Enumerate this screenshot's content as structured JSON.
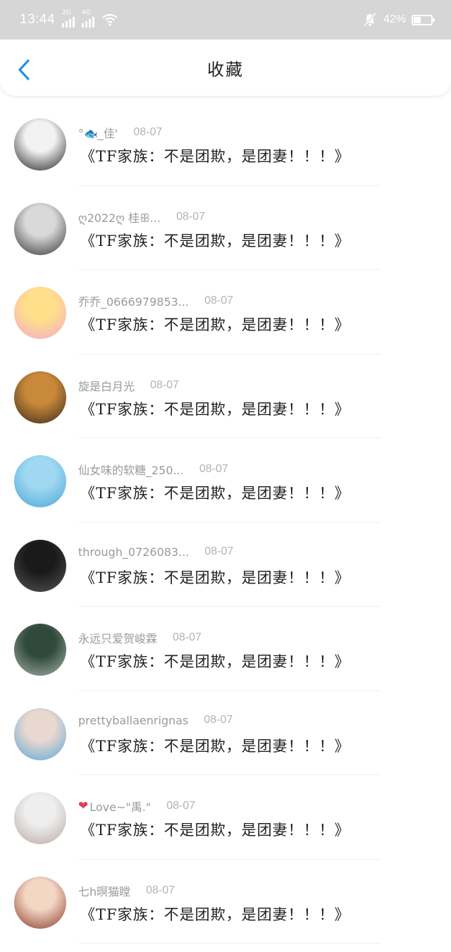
{
  "status_bar": {
    "time": "13:44",
    "signal1_tag": "2G",
    "signal2_tag": "4G",
    "battery_percent": "42%",
    "battery_level": 0.42
  },
  "header": {
    "title": "收藏",
    "back_icon": "chevron-left-icon"
  },
  "colors": {
    "accent": "#2b8de9",
    "status_bar_bg": "#d6d6d6",
    "username": "#9a9a9a",
    "date": "#b3b3b3"
  },
  "items": [
    {
      "username": "°🐟_佳'",
      "date": "08-07",
      "content": "《TF家族：不是团欺，是团妻！！！》",
      "avatar_colors": [
        "#f2f2f2",
        "#222222"
      ]
    },
    {
      "username": "ღ2022ღ 桂ꕥ...",
      "date": "08-07",
      "content": "《TF家族：不是团欺，是团妻！！！》",
      "avatar_colors": [
        "#d9d9d9",
        "#333333"
      ]
    },
    {
      "username": "乔乔_0666979853...",
      "date": "08-07",
      "content": "《TF家族：不是团欺，是团妻！！！》",
      "avatar_colors": [
        "#ffe08a",
        "#f4a8c9"
      ]
    },
    {
      "username": "旋是白月光",
      "date": "08-07",
      "content": "《TF家族：不是团欺，是团妻！！！》",
      "avatar_colors": [
        "#c9893b",
        "#3a2a1c"
      ]
    },
    {
      "username": "仙女味的软糖_250...",
      "date": "08-07",
      "content": "《TF家族：不是团欺，是团妻！！！》",
      "avatar_colors": [
        "#9fd8f0",
        "#4aa7d6"
      ]
    },
    {
      "username": "through_0726083...",
      "date": "08-07",
      "content": "《TF家族：不是团欺，是团妻！！！》",
      "avatar_colors": [
        "#1a1a1a",
        "#555555"
      ]
    },
    {
      "username": "永远只爱贺峻霖",
      "date": "08-07",
      "content": "《TF家族：不是团欺，是团妻！！！》",
      "avatar_colors": [
        "#2f4a3a",
        "#a8b3aa"
      ]
    },
    {
      "username": "prettyballaenrignas",
      "date": "08-07",
      "content": "《TF家族：不是团欺，是团妻！！！》",
      "avatar_colors": [
        "#e8d8d0",
        "#5aa7d8"
      ]
    },
    {
      "username": "Love~\"禹.\"",
      "date": "08-07",
      "content": "《TF家族：不是团欺，是团妻！！！》",
      "avatar_colors": [
        "#eeeeee",
        "#b7a8a3"
      ],
      "heart": "❤"
    },
    {
      "username": "七h暝猫瞠",
      "date": "08-07",
      "content": "《TF家族：不是团欺，是团妻！！！》",
      "avatar_colors": [
        "#f3d7c4",
        "#8a3a2a"
      ]
    }
  ]
}
